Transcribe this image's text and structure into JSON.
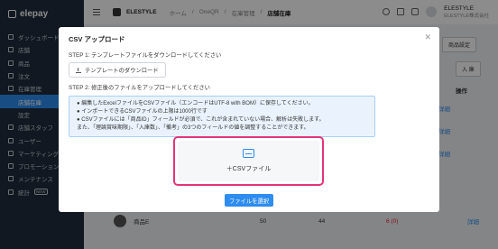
{
  "app": {
    "name": "elepay"
  },
  "sidebar": {
    "items": [
      {
        "label": "ダッシュボード"
      },
      {
        "label": "店舗"
      },
      {
        "label": "商品"
      },
      {
        "label": "注文"
      },
      {
        "label": "在庫管理"
      },
      {
        "label": "店舗在庫"
      },
      {
        "label": "設定"
      },
      {
        "label": "店舗スタッフ"
      },
      {
        "label": "ユーザー"
      },
      {
        "label": "マーケティング",
        "badge": "NEW"
      },
      {
        "label": "プロモーション"
      },
      {
        "label": "メンテナンス"
      },
      {
        "label": "統計",
        "badge": "NEW"
      }
    ]
  },
  "header": {
    "store_name": "ELESTYLE",
    "breadcrumb": [
      "ホーム",
      "OneQR",
      "在庫管理",
      "店舗在庫"
    ],
    "user_name": "ELESTYLE",
    "user_company": "ELESTYLE株式会社"
  },
  "background": {
    "product_settings_label": "商品設定",
    "import_label": "入 庫",
    "operation_header": "操作",
    "row": {
      "name": "商品E",
      "col1": "50",
      "col2": "44",
      "col3": "6 (0)",
      "action": "詳細"
    },
    "action_labels": [
      "詳細",
      "詳細",
      "詳細"
    ]
  },
  "modal": {
    "title": "CSV アップロード",
    "step1": "STEP 1: テンプレートファイルをダウンロードしてください",
    "download_button": "テンプレートのダウンロード",
    "step2": "STEP 2: 修正後のファイルをアップロードしてください",
    "info_lines": [
      "● 編集したExcelファイルをCSVファイル（エンコードはUTF-8 with BOM）に保存してください。",
      "● インポートできるCSVファイルの上限は1000行です",
      "● CSVファイルには「商品ID」フィールドが必須で、これが含まれていない場合、解析は失敗します。",
      "また、「理論賞味期限」、「入庫数」、「備考」の3つのフィールドの値を調整することができます。"
    ],
    "drop_label": "＋CSVファイル",
    "select_button": "ファイルを選択"
  },
  "colors": {
    "accent": "#2d8cf0",
    "highlight": "#e2357a",
    "sidebar": "#1f2d3d"
  }
}
